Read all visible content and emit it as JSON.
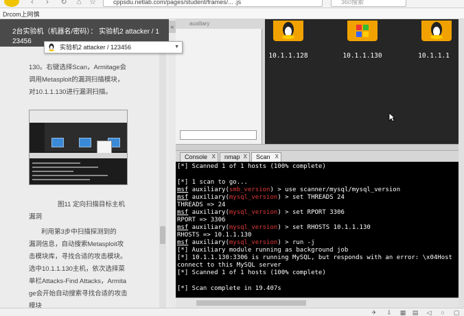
{
  "browser": {
    "url": "cppsdu.netlab.com/pages/student/frames/... .js",
    "search_placeholder": "360搜索",
    "bookmark": "Drcom上网慎"
  },
  "left": {
    "header_line1": "2台实验机（机器名/密码）： 实验机2  attacker / 1",
    "header_line2": "23456",
    "para1": [
      "130。右键选择Scan，Armitage会",
      "调用Metasploit的漏洞扫描模块，",
      "对10.1.1.130进行漏洞扫描。"
    ],
    "caption": [
      "图11 定向扫描目标主机",
      "漏洞"
    ],
    "para2": [
      "利用第3步中扫描探测到的",
      "漏洞信息，自动搜索Metasploit攻",
      "击模块库，寻找合适的攻击模块。",
      "选中10.1.1.130主机，依次选择菜",
      "单栏Attacks-Find Attacks，Armita",
      "ge会开始自动搜索寻找合适的攻击",
      "模块"
    ]
  },
  "tooltip": {
    "text": "实验机2     attacker / 123456"
  },
  "module_tree": {
    "header": "auxiliary"
  },
  "hosts": [
    "10.1.1.128",
    "10.1.1.130",
    "10.1.1.1"
  ],
  "tabs": [
    "Console",
    "nmap",
    "Scan"
  ],
  "console": {
    "l1": "[*] Scanned 1 of 1 hosts (100% complete)",
    "l2": "[*] 1 scan to go...",
    "msf": "msf",
    "aux": "auxiliary(",
    "close": ")",
    "m_smb": "smb_version",
    "m_mysql": "mysql_version",
    "cmd1": " > use scanner/mysql/mysql_version",
    "cmd2": " > set THREADS 24",
    "out2": "THREADS => 24",
    "cmd3": " > set RPORT 3306",
    "out3": "RPORT => 3306",
    "cmd4": " > set RHOSTS 10.1.1.130",
    "out4": "RHOSTS => 10.1.1.130",
    "cmd5": " > run -j",
    "l_bg": "[*] Auxiliary module running as background job",
    "l_mysql1": "[*] 10.1.1.130:3306 is running MySQL, but responds with an error: \\x04Host",
    "l_mysql2": "connect to this MySQL server",
    "l_scanned": "[*] Scanned 1 of 1 hosts (100% complete)",
    "l_complete": "[*] Scan complete in 19.407s"
  }
}
